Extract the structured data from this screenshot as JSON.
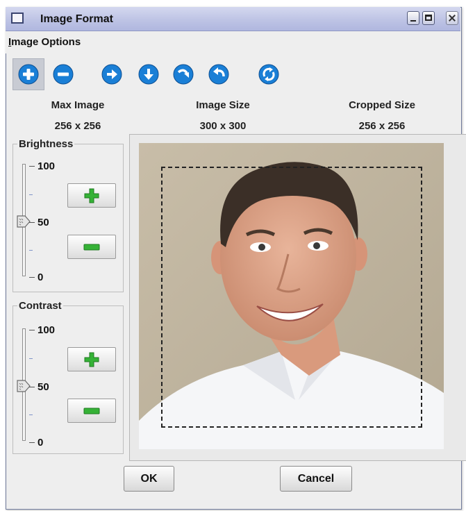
{
  "window": {
    "title": "Image Format"
  },
  "menu": {
    "image_options": {
      "mnemonic": "I",
      "rest": "mage Options"
    }
  },
  "toolbar": {
    "tools": [
      {
        "icon": "zoom-in-icon",
        "active": true
      },
      {
        "icon": "zoom-out-icon"
      },
      {
        "icon": "arrow-right-icon"
      },
      {
        "icon": "arrow-down-icon"
      },
      {
        "icon": "rotate-clockwise-icon"
      },
      {
        "icon": "rotate-counterclockwise-icon"
      },
      {
        "icon": "reset-rotate-icon"
      }
    ]
  },
  "info": {
    "max_image_label": "Max Image",
    "max_image_value": "256 x 256",
    "image_size_label": "Image Size",
    "image_size_value": "300 x 300",
    "cropped_size_label": "Cropped Size",
    "cropped_size_value": "256 x 256"
  },
  "brightness": {
    "legend": "Brightness",
    "tick_max": "100",
    "tick_mid": "50",
    "tick_min": "0",
    "value": 50
  },
  "contrast": {
    "legend": "Contrast",
    "tick_max": "100",
    "tick_mid": "50",
    "tick_min": "0",
    "value": 50
  },
  "buttons": {
    "ok": "OK",
    "cancel": "Cancel"
  },
  "colors": {
    "icon_blue": "#1a7fd6",
    "plus_green": "#35b236",
    "titlebar": "#bcc2e4"
  }
}
